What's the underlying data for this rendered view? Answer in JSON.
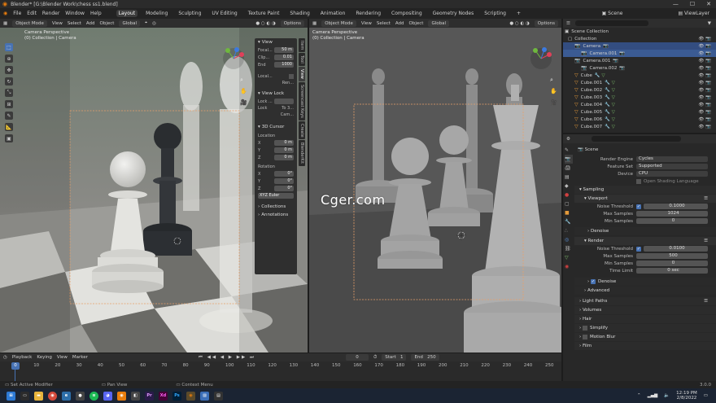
{
  "window": {
    "title": "Blender* [G:\\Blender Work\\chess ss1.blend]",
    "min": "—",
    "max": "☐",
    "close": "✕"
  },
  "menu": [
    "File",
    "Edit",
    "Render",
    "Window",
    "Help"
  ],
  "workspaces": [
    "Layout",
    "Modeling",
    "Sculpting",
    "UV Editing",
    "Texture Paint",
    "Shading",
    "Animation",
    "Rendering",
    "Compositing",
    "Geometry Nodes",
    "Scripting",
    "+"
  ],
  "scene_name": "Scene",
  "view_layer": "ViewLayer",
  "left_viewport": {
    "mode": "Object Mode",
    "menus": [
      "View",
      "Select",
      "Add",
      "Object"
    ],
    "orientation": "Global",
    "options": "Options",
    "overlay_title": "Camera Perspective",
    "overlay_sub": "(0) Collection | Camera"
  },
  "right_viewport": {
    "mode": "Object Mode",
    "menus": [
      "View",
      "Select",
      "Add",
      "Object"
    ],
    "orientation": "Global",
    "options": "Options",
    "overlay_title": "Camera Perspective",
    "overlay_sub": "(0) Collection | Camera"
  },
  "watermark": "Cger.com",
  "npanel": {
    "view_header": "View",
    "focal_label": "Focal...",
    "focal_value": "50 m",
    "clip_label": "Clip...",
    "clip_start": "0.01",
    "end_label": "End",
    "clip_end": "1000",
    "local_label": "Local...",
    "rend_label": "Ren...",
    "view_lock_header": "View Lock",
    "lock_obj_label": "Lock ...",
    "lock_label": "Lock",
    "lock_to3d": "To 3...",
    "cam_label": "Cam...",
    "cursor_header": "3D Cursor",
    "location_label": "Location",
    "x_label": "X",
    "x_value": "0 m",
    "y_label": "Y",
    "y_value": "0 m",
    "z_label": "Z",
    "z_value": "0 m",
    "rotation_label": "Rotation",
    "rx_label": "X",
    "rx_value": "0°",
    "ry_label": "Y",
    "ry_value": "0°",
    "rz_label": "Z",
    "rz_value": "0°",
    "rot_mode": "XYZ Euler",
    "collections_header": "Collections",
    "annotations_header": "Annotations",
    "vtabs": [
      "Item",
      "Tool",
      "View",
      "Screencast Keys",
      "Create",
      "BlenderKit"
    ]
  },
  "outliner": {
    "root": "Scene Collection",
    "items": [
      {
        "name": "Collection",
        "indent": 0
      },
      {
        "name": "Camera",
        "indent": 1
      },
      {
        "name": "Camera.001",
        "indent": 2
      },
      {
        "name": "Camera.001",
        "indent": 1
      },
      {
        "name": "Camera.002",
        "indent": 2
      },
      {
        "name": "Cube",
        "indent": 1
      },
      {
        "name": "Cube.001",
        "indent": 1
      },
      {
        "name": "Cube.002",
        "indent": 1
      },
      {
        "name": "Cube.003",
        "indent": 1
      },
      {
        "name": "Cube.004",
        "indent": 1
      },
      {
        "name": "Cube.005",
        "indent": 1
      },
      {
        "name": "Cube.006",
        "indent": 1
      },
      {
        "name": "Cube.007",
        "indent": 1
      }
    ]
  },
  "properties": {
    "scene_label": "Scene",
    "render_engine_label": "Render Engine",
    "render_engine": "Cycles",
    "feature_set_label": "Feature Set",
    "feature_set": "Supported",
    "device_label": "Device",
    "device": "CPU",
    "osl_label": "Open Shading Language",
    "sampling": "Sampling",
    "viewport": "Viewport",
    "vp_noise_label": "Noise Threshold",
    "vp_noise": "0.1000",
    "vp_max_label": "Max Samples",
    "vp_max": "1024",
    "vp_min_label": "Min Samples",
    "vp_min": "0",
    "denoise": "Denoise",
    "render": "Render",
    "r_noise_label": "Noise Threshold",
    "r_noise": "0.0100",
    "r_max_label": "Max Samples",
    "r_max": "500",
    "r_min_label": "Min Samples",
    "r_min": "0",
    "time_label": "Time Limit",
    "time_value": "0 sec",
    "denoise2": "Denoise",
    "advanced": "Advanced",
    "light_paths": "Light Paths",
    "volumes": "Volumes",
    "hair": "Hair",
    "simplify": "Simplify",
    "motion_blur": "Motion Blur",
    "film": "Film"
  },
  "timeline": {
    "menus": [
      "Playback",
      "Keying",
      "View",
      "Marker"
    ],
    "current_frame": "0",
    "start_label": "Start",
    "start": "1",
    "end_label": "End",
    "end": "250",
    "ticks": [
      "0",
      "10",
      "20",
      "30",
      "40",
      "50",
      "60",
      "70",
      "80",
      "90",
      "100",
      "110",
      "120",
      "130",
      "140",
      "150",
      "160",
      "170",
      "180",
      "190",
      "200",
      "210",
      "220",
      "230",
      "240",
      "250"
    ]
  },
  "statusbar": {
    "left": "Set Active Modifier",
    "mid": "Pan View",
    "right": "Context Menu",
    "version": "3.0.0"
  },
  "taskbar": {
    "time": "12:19 PM",
    "date": "2/8/2022"
  }
}
